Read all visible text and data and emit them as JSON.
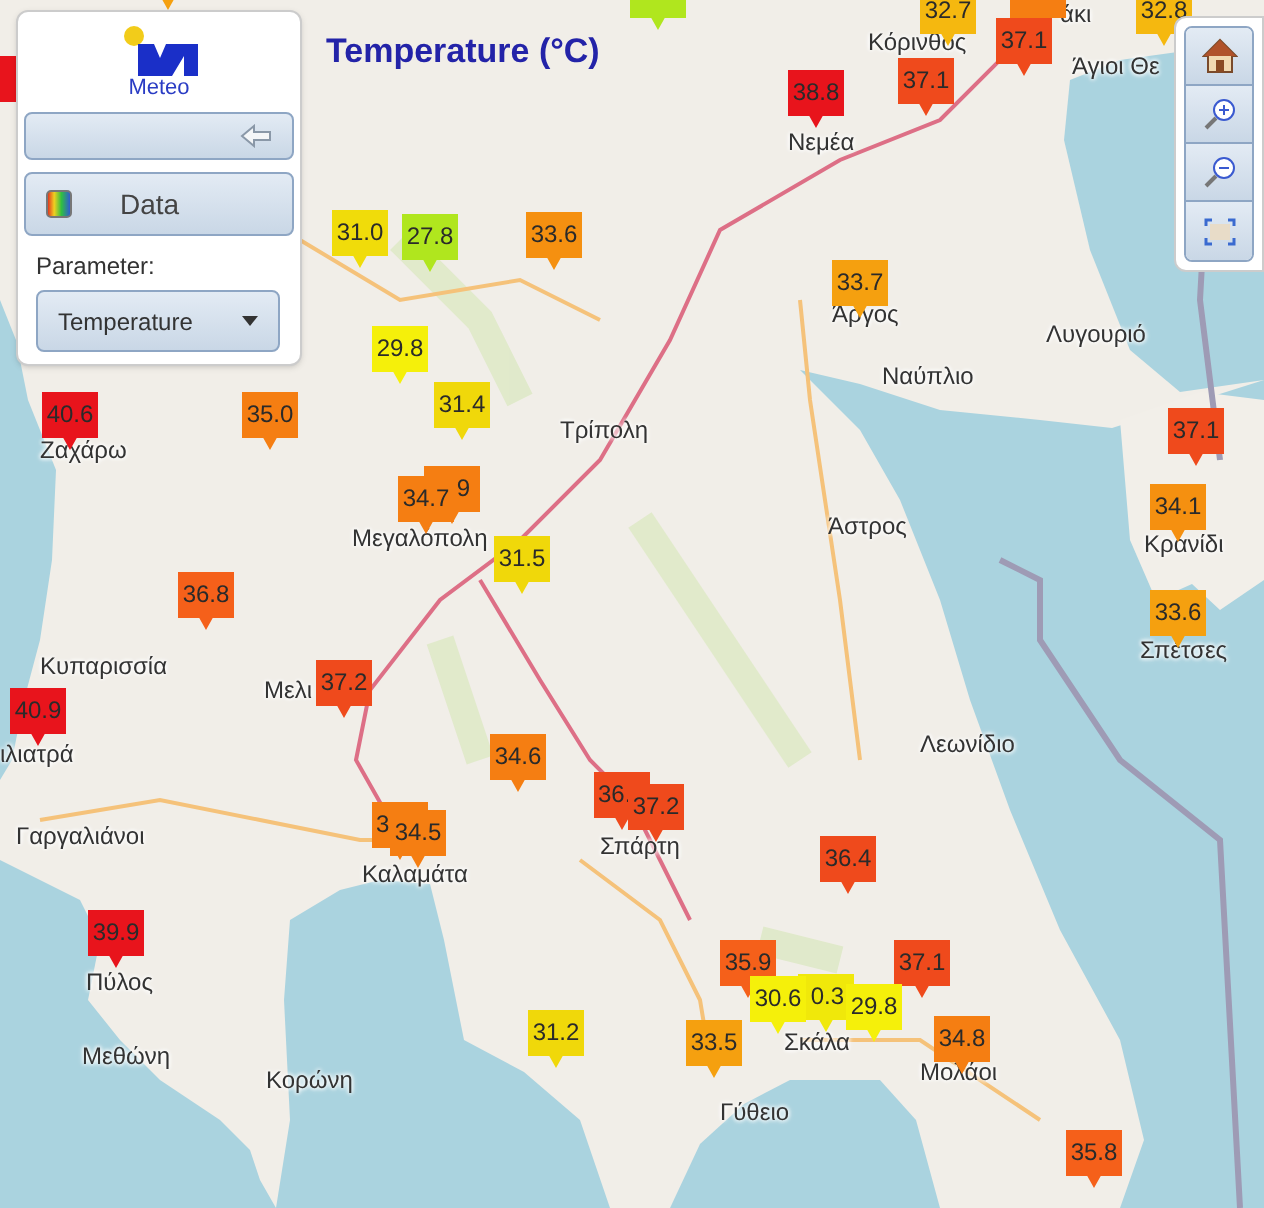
{
  "title": "Temperature (°C)",
  "panel": {
    "logo_text": "Meteo",
    "data_button": "Data",
    "parameter_label": "Parameter:",
    "parameter_value": "Temperature"
  },
  "places": [
    {
      "name": "άκι"
    },
    {
      "name": "Κόρινθος"
    },
    {
      "name": "Άγιοι Θε"
    },
    {
      "name": "Νεμέα"
    },
    {
      "name": "Άργος"
    },
    {
      "name": "Ναύπλιο"
    },
    {
      "name": "Λυγουριό"
    },
    {
      "name": "Τρίπολη"
    },
    {
      "name": "Άστρος"
    },
    {
      "name": "Κρανίδι"
    },
    {
      "name": "Σπέτσες"
    },
    {
      "name": "Λεωνίδιο"
    },
    {
      "name": "Ζαχάρω"
    },
    {
      "name": "Μεγαλόπολη"
    },
    {
      "name": "Κυπαρισσία"
    },
    {
      "name": "Μελι"
    },
    {
      "name": "ιλιατρά"
    },
    {
      "name": "Γαργαλιάνοι"
    },
    {
      "name": "Καλαμάτα"
    },
    {
      "name": "Σπάρτη"
    },
    {
      "name": "Πύλος"
    },
    {
      "name": "Σκάλα"
    },
    {
      "name": "Μολάοι"
    },
    {
      "name": "Μεθώνη"
    },
    {
      "name": "Κορώνη"
    },
    {
      "name": "Γύθειο"
    }
  ],
  "markers": [
    {
      "kind": "full",
      "color": "#f5a00f"
    },
    {
      "kind": "full",
      "color": "#b0e61e"
    },
    {
      "kind": "full",
      "value": "32.7",
      "color": "#f5b80f"
    },
    {
      "kind": "full",
      "color": "#f57e12"
    },
    {
      "kind": "full",
      "value": "32.8",
      "color": "#f5b80f"
    },
    {
      "kind": "full",
      "color": "#e8141c"
    },
    {
      "kind": "full",
      "value": "38.8",
      "color": "#e8141c"
    },
    {
      "kind": "full",
      "value": "37.1",
      "color": "#ef4a1c"
    },
    {
      "kind": "full",
      "value": "37.1",
      "color": "#ef4a1c"
    },
    {
      "kind": "full",
      "value": "31.0",
      "color": "#f0dc0a"
    },
    {
      "kind": "full",
      "value": "27.8",
      "color": "#b0e61e"
    },
    {
      "kind": "full",
      "value": "33.6",
      "color": "#f59010"
    },
    {
      "kind": "full",
      "value": "33.7",
      "color": "#f5a00f"
    },
    {
      "kind": "full",
      "value": "29.8",
      "color": "#f5f00a"
    },
    {
      "kind": "full",
      "value": "31.4",
      "color": "#f0d80a"
    },
    {
      "kind": "full",
      "value": "40.6",
      "color": "#e8141c"
    },
    {
      "kind": "full",
      "value": "35.0",
      "color": "#f57e12"
    },
    {
      "kind": "full",
      "value": "34.7",
      "color": "#f57e12"
    },
    {
      "kind": "clipped_left",
      "value": "9",
      "color": "#f57e12"
    },
    {
      "kind": "full",
      "value": "31.5",
      "color": "#f0d80a"
    },
    {
      "kind": "full",
      "value": "37.1",
      "color": "#ef4a1c"
    },
    {
      "kind": "full",
      "value": "34.1",
      "color": "#f59010"
    },
    {
      "kind": "full",
      "value": "36.8",
      "color": "#f5601a"
    },
    {
      "kind": "full",
      "value": "33.6",
      "color": "#f5a00f"
    },
    {
      "kind": "full",
      "value": "37.2",
      "color": "#ef4a1c"
    },
    {
      "kind": "full",
      "value": "40.9",
      "color": "#e8141c"
    },
    {
      "kind": "full",
      "value": "34.6",
      "color": "#f57e12"
    },
    {
      "kind": "clipped_right",
      "value": "36.",
      "color": "#ef4a1c"
    },
    {
      "kind": "full",
      "value": "37.2",
      "color": "#ef4a1c"
    },
    {
      "kind": "clipped_right",
      "value": "3",
      "color": "#f57e12"
    },
    {
      "kind": "full",
      "value": "34.5",
      "color": "#f57e12"
    },
    {
      "kind": "full",
      "value": "36.4",
      "color": "#ef4a1c"
    },
    {
      "kind": "full",
      "value": "39.9",
      "color": "#e8141c"
    },
    {
      "kind": "full",
      "value": "35.9",
      "color": "#f5601a"
    },
    {
      "kind": "full",
      "value": "37.1",
      "color": "#ef4a1c"
    },
    {
      "kind": "full",
      "value": "30.6",
      "color": "#f5f00a"
    },
    {
      "kind": "clipped_left",
      "value": "0.3",
      "color": "#f0e80a"
    },
    {
      "kind": "full",
      "value": "29.8",
      "color": "#f5f00a"
    },
    {
      "kind": "full",
      "value": "31.2",
      "color": "#f0d80a"
    },
    {
      "kind": "full",
      "value": "33.5",
      "color": "#f5a00f"
    },
    {
      "kind": "full",
      "value": "34.8",
      "color": "#f57e12"
    },
    {
      "kind": "full",
      "value": "35.8",
      "color": "#f5601a"
    }
  ]
}
